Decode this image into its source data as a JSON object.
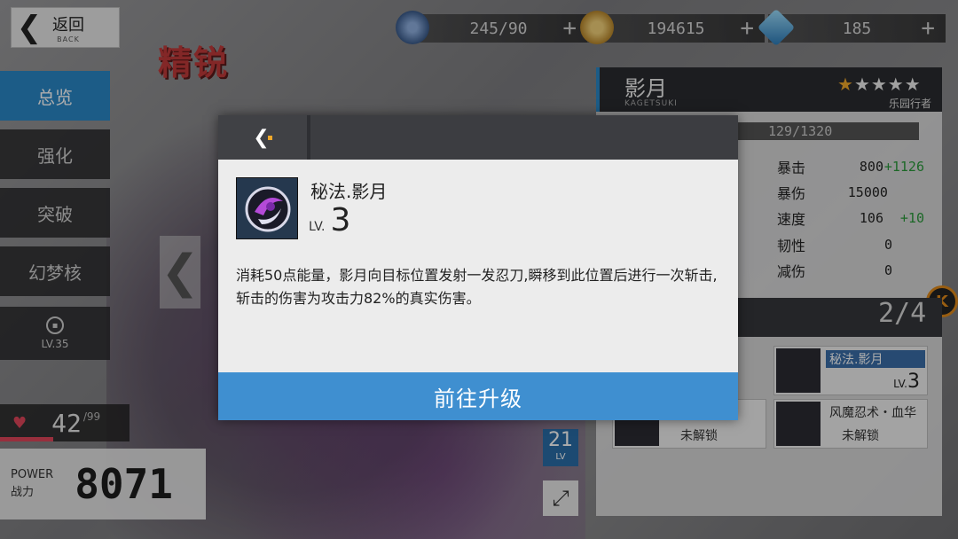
{
  "back": {
    "label_zh": "返回",
    "label_en": "BACK"
  },
  "resources": [
    {
      "icon": "stamina-icon",
      "value": "245/90",
      "plus": "+"
    },
    {
      "icon": "gold-coin-icon",
      "value": "194615",
      "plus": "+"
    },
    {
      "icon": "crystal-icon",
      "value": "185",
      "plus": "+"
    }
  ],
  "page_title": "精锐",
  "menu": [
    {
      "label": "总览",
      "active": true
    },
    {
      "label": "强化"
    },
    {
      "label": "突破"
    },
    {
      "label": "幻梦核"
    },
    {
      "label": "LV.35",
      "locked": true
    }
  ],
  "hp": {
    "value": "42",
    "max": "/99"
  },
  "power": {
    "label_en": "POWER",
    "label_zh": "战力",
    "value": "8071"
  },
  "character": {
    "name": "影月",
    "name_en": "KAGETSUKI",
    "stars_on": "★",
    "stars_off": "★★★★",
    "role": "乐园行者",
    "exp": "129/1320",
    "stats": [
      {
        "name": "暴击",
        "value": "800",
        "bonus": "+1126"
      },
      {
        "name": "暴伤",
        "value": "15000",
        "bonus": ""
      },
      {
        "name": "速度",
        "value": "106",
        "bonus": "+10"
      },
      {
        "name": "韧性",
        "value": "0",
        "bonus": ""
      },
      {
        "name": "减伤",
        "value": "0",
        "bonus": ""
      }
    ],
    "skill_count": "2/4",
    "level_badge": {
      "value": "21",
      "unit": "LV"
    }
  },
  "skill_cards": [
    {
      "name": "秘法.影月",
      "lv_prefix": "LV.",
      "lv": "3"
    },
    {
      "name": "风魔忍术・血华",
      "status": "未解锁"
    },
    {
      "status": "未解锁"
    }
  ],
  "modal": {
    "skill_name": "秘法.影月",
    "lv_prefix": "LV.",
    "lv_value": "3",
    "description": "消耗50点能量，影月向目标位置发射一发忍刀,瞬移到此位置后进行一次斩击,斩击的伤害为攻击力82%的真实伤害。",
    "button": "前往升级"
  },
  "colors": {
    "accent": "#3f8fd0",
    "menu_active": "#2a88c8",
    "gold": "#f0a82a",
    "hp": "#e0465a"
  }
}
